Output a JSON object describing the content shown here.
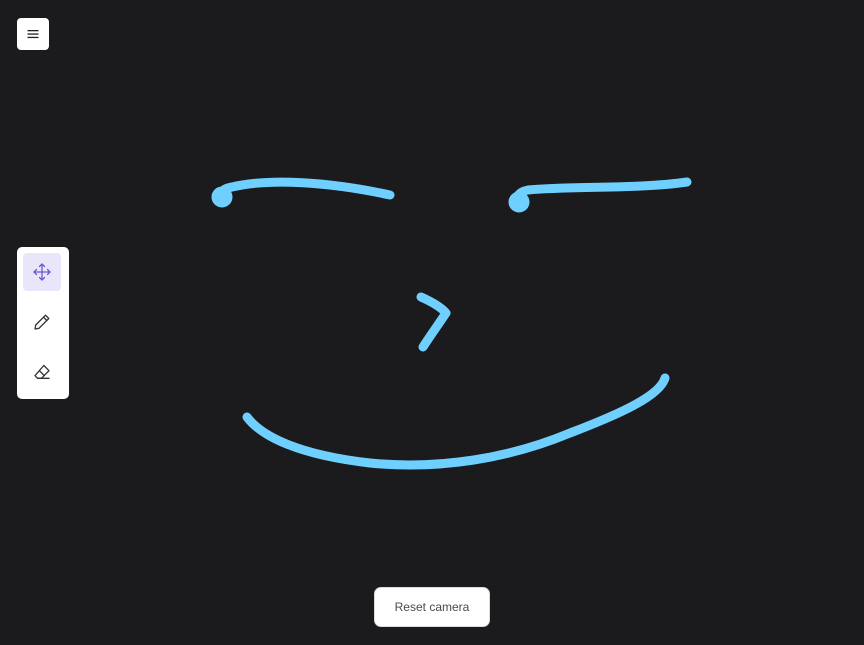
{
  "colors": {
    "background": "#1b1a1c",
    "stroke": "#6fd0ff",
    "panel": "#ffffff",
    "active_tool_bg": "#e9e6fb",
    "active_tool_icon": "#6a5acd",
    "icon": "#333333"
  },
  "menu": {
    "icon": "hamburger-menu-icon"
  },
  "toolbar": {
    "tools": [
      {
        "name": "move",
        "icon": "move-arrows-icon",
        "active": true
      },
      {
        "name": "pen",
        "icon": "pencil-icon",
        "active": false
      },
      {
        "name": "eraser",
        "icon": "eraser-icon",
        "active": false
      }
    ]
  },
  "footer": {
    "reset_camera_label": "Reset camera"
  }
}
